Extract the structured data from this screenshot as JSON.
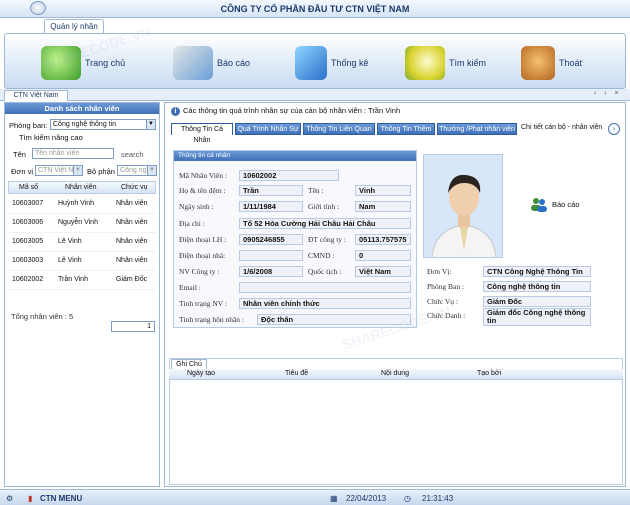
{
  "window": {
    "title": "CÔNG TY CỔ PHẦN ĐẦU TƯ CTN VIỆT NAM"
  },
  "ribbon": {
    "tab": "Quản lý nhân sự",
    "buttons": [
      {
        "label": "Trang chủ",
        "icon": "home-icon"
      },
      {
        "label": "Báo cáo",
        "icon": "report-icon"
      },
      {
        "label": "Thống kê",
        "icon": "statistics-icon"
      },
      {
        "label": "Tìm kiếm",
        "icon": "search-icon"
      },
      {
        "label": "Thoát",
        "icon": "exit-icon"
      }
    ]
  },
  "doc_tab": "CTN Việt Nam",
  "left_panel": {
    "title": "Danh sách nhân viên",
    "department_label": "Phòng ban:",
    "department_value": "Công nghệ thông tin",
    "advanced_search_label": "Tìm kiếm nâng cao",
    "name_label": "Tên",
    "name_placeholder": "Tên nhân viên",
    "search_button": "search",
    "unit_label": "Đơn vị",
    "unit_value": "CTN Việt Nam",
    "dept_label": "Bộ phận",
    "dept_value": "Công nghệ",
    "columns": [
      "Mã số",
      "Nhân viên",
      "Chức vụ"
    ],
    "rows": [
      [
        "10603007",
        "Huỳnh Vinh",
        "Nhân viên"
      ],
      [
        "10603006",
        "Nguyễn Vinh",
        "Nhân viên"
      ],
      [
        "10603005",
        "Lê Vinh",
        "Nhân viên"
      ],
      [
        "10603003",
        "Lê Vinh",
        "Nhân viên"
      ],
      [
        "10602002",
        "Trần Vinh",
        "Giám Đốc"
      ]
    ],
    "total_label": "Tổng nhân viên : 5",
    "page_value": "1"
  },
  "main": {
    "info_text": "Các thông tin  quá trình nhân sự của cán bộ nhân viên : Trần Vinh",
    "tabs": [
      "Thông Tin Cá Nhân",
      "Quá Trình Nhân Sự",
      "Thông Tin Liên Quan",
      "Thông Tin Thêm",
      "Thưởng /Phạt nhân viên"
    ],
    "detail_tab": "Chi tiết cán bộ - nhân viên",
    "personal_box_title": "Thông tin cá nhân",
    "fields": {
      "employee_id_label": "Mã Nhân Viên :",
      "employee_id": "10602002",
      "surname_label": "Họ & tên đệm :",
      "surname": "Trần",
      "given_label": "Tên :",
      "given": "Vinh",
      "dob_label": "Ngày sinh :",
      "dob": "1/11/1984",
      "gender_label": "Giới tính :",
      "gender": "Nam",
      "address_label": "Địa chỉ :",
      "address": "Tổ 52 Hòa Cường Hải Châu Hải Châu",
      "phone_label": "Điện thoại LH :",
      "phone": "0905246855",
      "company_phone_label": "ĐT công ty :",
      "company_phone": "05113.757575",
      "home_phone_label": "Điện thoại nhà:",
      "home_phone": "",
      "id_card_label": "CMND :",
      "id_card": "0",
      "start_label": "NV Công ty :",
      "start_date": "1/6/2008",
      "nationality_label": "Quốc tịch :",
      "nationality": "Việt Nam",
      "email_label": "Email :",
      "email": "",
      "status_label": "Tình trạng NV :",
      "status": "Nhân viên chính thức",
      "marital_label": "Tình trạng hôn nhân :",
      "marital": "Độc thân"
    },
    "report_button": "Báo cáo",
    "org": {
      "unit_label": "Đơn Vị:",
      "unit": "CTN Công Nghệ Thông Tin",
      "dept_label": "Phòng Ban :",
      "dept": "Công nghệ thông tin",
      "position_label": "Chức Vụ :",
      "position": "Giám Đốc",
      "title_label": "Chức Danh :",
      "title": "Giám đốc Công nghệ thông tin"
    },
    "notes_tab": "Ghi Chú",
    "notes_columns": [
      "Ngày tạo",
      "Tiêu đề",
      "Nội dung",
      "Tạo bởi"
    ]
  },
  "status_bar": {
    "menu": "CTN MENU",
    "date": "22/04/2013",
    "time": "21:31:43"
  }
}
